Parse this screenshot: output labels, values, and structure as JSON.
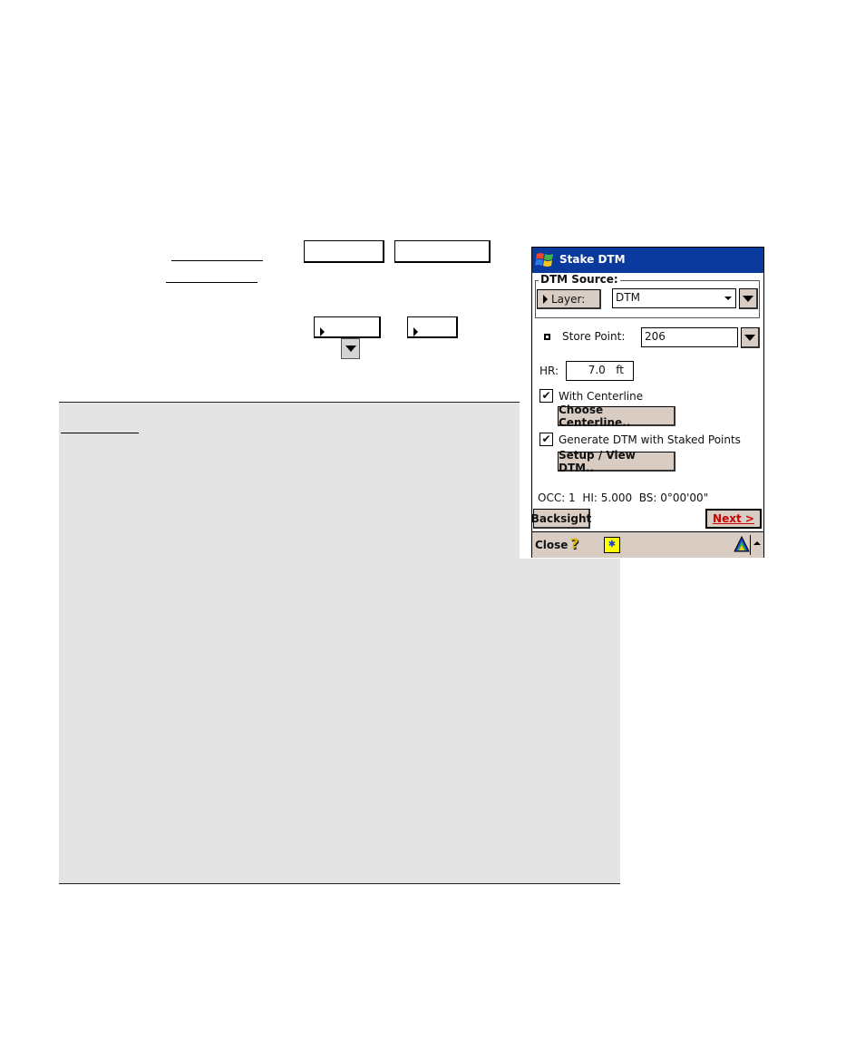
{
  "dialog": {
    "title": "Stake DTM",
    "group_label": "DTM Source:",
    "layer_button": "Layer:",
    "layer_value": "DTM",
    "store_point_label": "Store Point:",
    "store_point_value": "206",
    "hr_label": "HR:",
    "hr_value": "7.0",
    "hr_unit": "ft",
    "with_centerline_label": "With Centerline",
    "with_centerline_checked": true,
    "choose_centerline_button": "Choose Centerline..",
    "generate_dtm_label": "Generate DTM with Staked Points",
    "generate_dtm_checked": true,
    "setup_dtm_button": "Setup / View DTM..",
    "status_line": "OCC: 1  HI: 5.000  BS: 0°00'00\"",
    "backsight_button": "Backsight",
    "next_button": "Next >",
    "close_label": "Close",
    "title_bar_color": "#0b3a9e",
    "next_color": "#cc0000"
  }
}
